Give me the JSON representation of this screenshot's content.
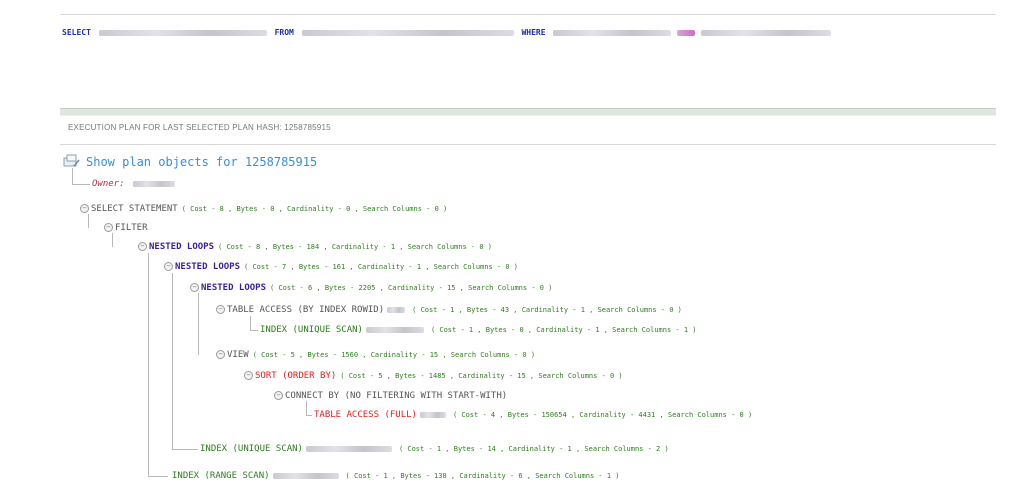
{
  "sql": {
    "select_kw": "SELECT",
    "from_kw": "FROM",
    "where_kw": "WHERE"
  },
  "section_header": "EXECUTION PLAN FOR LAST SELECTED PLAN HASH: 1258785915",
  "show_plan": "Show plan objects for 1258785915",
  "owner_label": "Owner:",
  "plan": [
    {
      "name": "SELECT STATEMENT",
      "stats": "( Cost - 8 , Bytes - 0 , Cardinality - 0 , Search Columns - 0 )"
    },
    {
      "name": "FILTER",
      "stats": ""
    },
    {
      "name": "NESTED LOOPS",
      "stats": "( Cost - 8 , Bytes - 184 , Cardinality - 1 , Search Columns - 0 )"
    },
    {
      "name": "NESTED LOOPS",
      "stats": "( Cost - 7 , Bytes - 161 , Cardinality - 1 , Search Columns - 0 )"
    },
    {
      "name": "NESTED LOOPS",
      "stats": "( Cost - 6 , Bytes - 2205 , Cardinality - 15 , Search Columns - 0 )"
    },
    {
      "name": "TABLE ACCESS (BY INDEX ROWID)",
      "stats": "( Cost - 1 , Bytes - 43 , Cardinality - 1 , Search Columns - 0 )"
    },
    {
      "name": "INDEX (UNIQUE SCAN)",
      "stats": "( Cost - 1 , Bytes - 0 , Cardinality - 1 , Search Columns - 1 )"
    },
    {
      "name": "VIEW",
      "stats": "( Cost - 5 , Bytes - 1560 , Cardinality - 15 , Search Columns - 0 )"
    },
    {
      "name": "SORT (ORDER BY)",
      "stats": "( Cost - 5 , Bytes - 1485 , Cardinality - 15 , Search Columns - 0 )"
    },
    {
      "name": "CONNECT BY (NO FILTERING WITH START-WITH)",
      "stats": ""
    },
    {
      "name": "TABLE ACCESS (FULL)",
      "stats": "( Cost - 4 , Bytes - 150654 , Cardinality - 4431 , Search Columns - 0 )"
    },
    {
      "name": "INDEX (UNIQUE SCAN)",
      "stats": "( Cost - 1 , Bytes - 14 , Cardinality - 1 , Search Columns - 2 )"
    },
    {
      "name": "INDEX (RANGE SCAN)",
      "stats": "( Cost - 1 , Bytes - 138 , Cardinality - 6 , Search Columns - 1 )"
    }
  ],
  "colors": {
    "keyword": "#1f2faa",
    "link": "#3a8fd0",
    "owner": "#b0304a",
    "join": "#3a1e9a",
    "stats": "#2e7d1e",
    "sort": "#e02020"
  }
}
